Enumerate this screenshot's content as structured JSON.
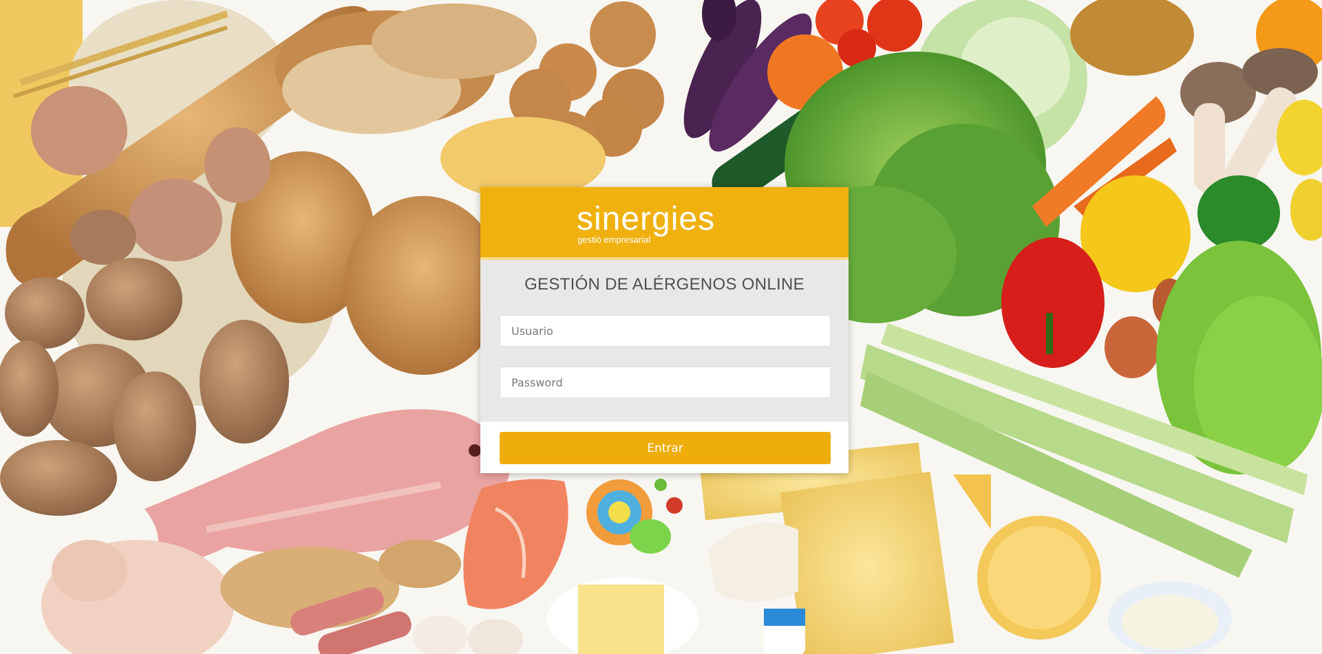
{
  "background": {
    "icon": "food-collage-background"
  },
  "brand": {
    "logo_text": "sinergies",
    "logo_tagline": "gestió empresarial",
    "accent_color": "#f0b10f",
    "button_color": "#efad0c"
  },
  "login": {
    "title": "GESTIÓN DE ALÉRGENOS ONLINE",
    "username_placeholder": "Usuario",
    "password_placeholder": "Password",
    "submit_label": "Entrar"
  }
}
